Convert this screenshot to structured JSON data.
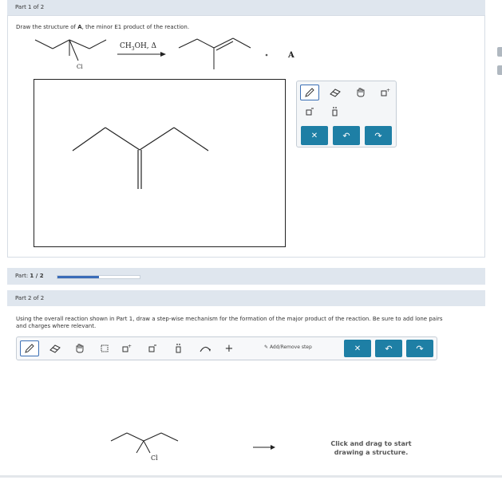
{
  "part1": {
    "header": "Part 1 of 2",
    "prompt_prefix": "Draw the structure of ",
    "prompt_bold": "A",
    "prompt_suffix": ", the minor E1 product of the reaction.",
    "reactant_label": "Cl",
    "reagent_main": "CH",
    "reagent_sub": "3",
    "reagent_rest": "OH, Δ",
    "plus": "+",
    "product_label": "A"
  },
  "toolbox1": {
    "tools": [
      "pencil-icon",
      "eraser-icon",
      "hand-icon",
      "charge-plus-icon",
      "charge-minus-icon",
      "lone-pair-icon"
    ],
    "actions": [
      "clear-icon",
      "undo-icon",
      "redo-icon"
    ],
    "clear_glyph": "✕",
    "undo_glyph": "↶",
    "redo_glyph": "↷"
  },
  "progress": {
    "label_prefix": "Part: ",
    "label_value": "1 / 2",
    "fraction": 0.5
  },
  "part2": {
    "header": "Part 2 of 2",
    "prompt_line1": "Using the overall reaction shown in Part 1, draw a step-wise mechanism for the formation of the major product of the reaction. Be sure to add lone pairs",
    "prompt_line2": "and charges where relevant.",
    "add_remove_step": "Add/Remove step",
    "plus_tool": "+",
    "reactant_label": "Cl",
    "hint": "Click and drag to start drawing a structure.",
    "clear_glyph": "✕",
    "undo_glyph": "↶",
    "redo_glyph": "↷"
  },
  "colors": {
    "header_bg": "#dfe6ee",
    "accent": "#1e7fa5",
    "progress": "#3a6cb8"
  }
}
